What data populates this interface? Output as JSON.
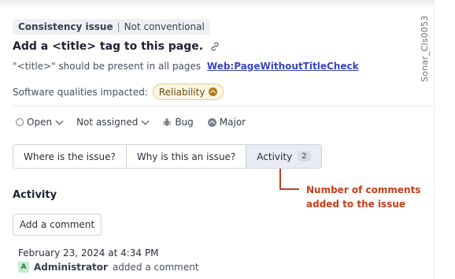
{
  "issue": {
    "tag_primary": "Consistency issue",
    "tag_separator": "|",
    "tag_secondary": "Not conventional",
    "title": "Add a <title> tag to this page.",
    "description": "\"<title>\" should be present in all pages",
    "rule_key": "Web:PageWithoutTitleCheck",
    "qualities_label": "Software qualities impacted:",
    "quality": "Reliability",
    "side_label": "Sonar_Cls0053"
  },
  "meta": {
    "status": "Open",
    "assignee": "Not assigned",
    "type": "Bug",
    "severity": "Major"
  },
  "tabs": [
    {
      "label": "Where is the issue?"
    },
    {
      "label": "Why is this an issue?"
    },
    {
      "label": "Activity",
      "badge": "2",
      "active": true
    }
  ],
  "annotation": {
    "line1": "Number of comments",
    "line2": "added to the issue",
    "color": "#c2401c"
  },
  "activity": {
    "title": "Activity",
    "add_comment_label": "Add a comment",
    "comment": {
      "date": "February 23, 2024 at 4:34 PM",
      "avatar_initial": "A",
      "author": "Administrator",
      "action": "added a comment"
    }
  },
  "colors": {
    "accent_link": "#3b46c2",
    "reliability_bg": "#fdf6e6",
    "reliability_border": "#e6c98a"
  }
}
